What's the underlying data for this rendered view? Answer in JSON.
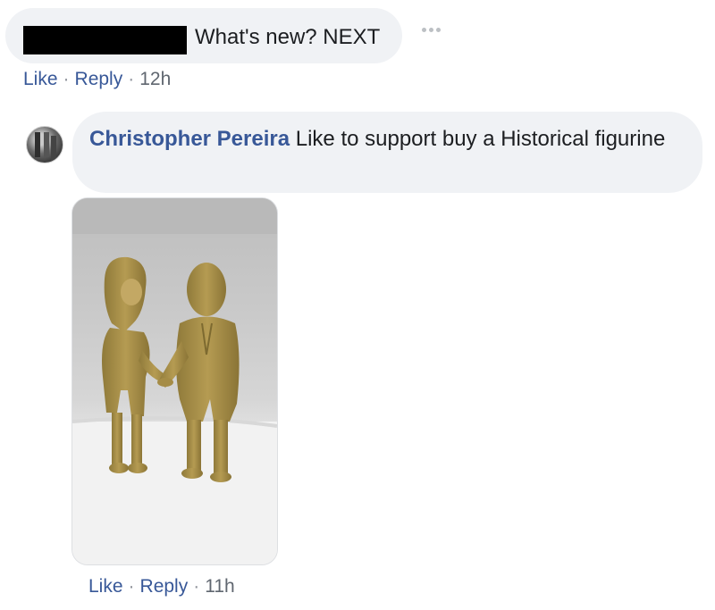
{
  "comment1": {
    "text": "What's new? NEXT",
    "actions": {
      "like": "Like",
      "reply": "Reply",
      "time": "12h"
    }
  },
  "comment2": {
    "author": "Christopher Pereira",
    "text": "Like to support buy a Historical figurine",
    "actions": {
      "like": "Like",
      "reply": "Reply",
      "time": "11h"
    }
  },
  "icons": {
    "more": "more-horizontal-icon"
  }
}
